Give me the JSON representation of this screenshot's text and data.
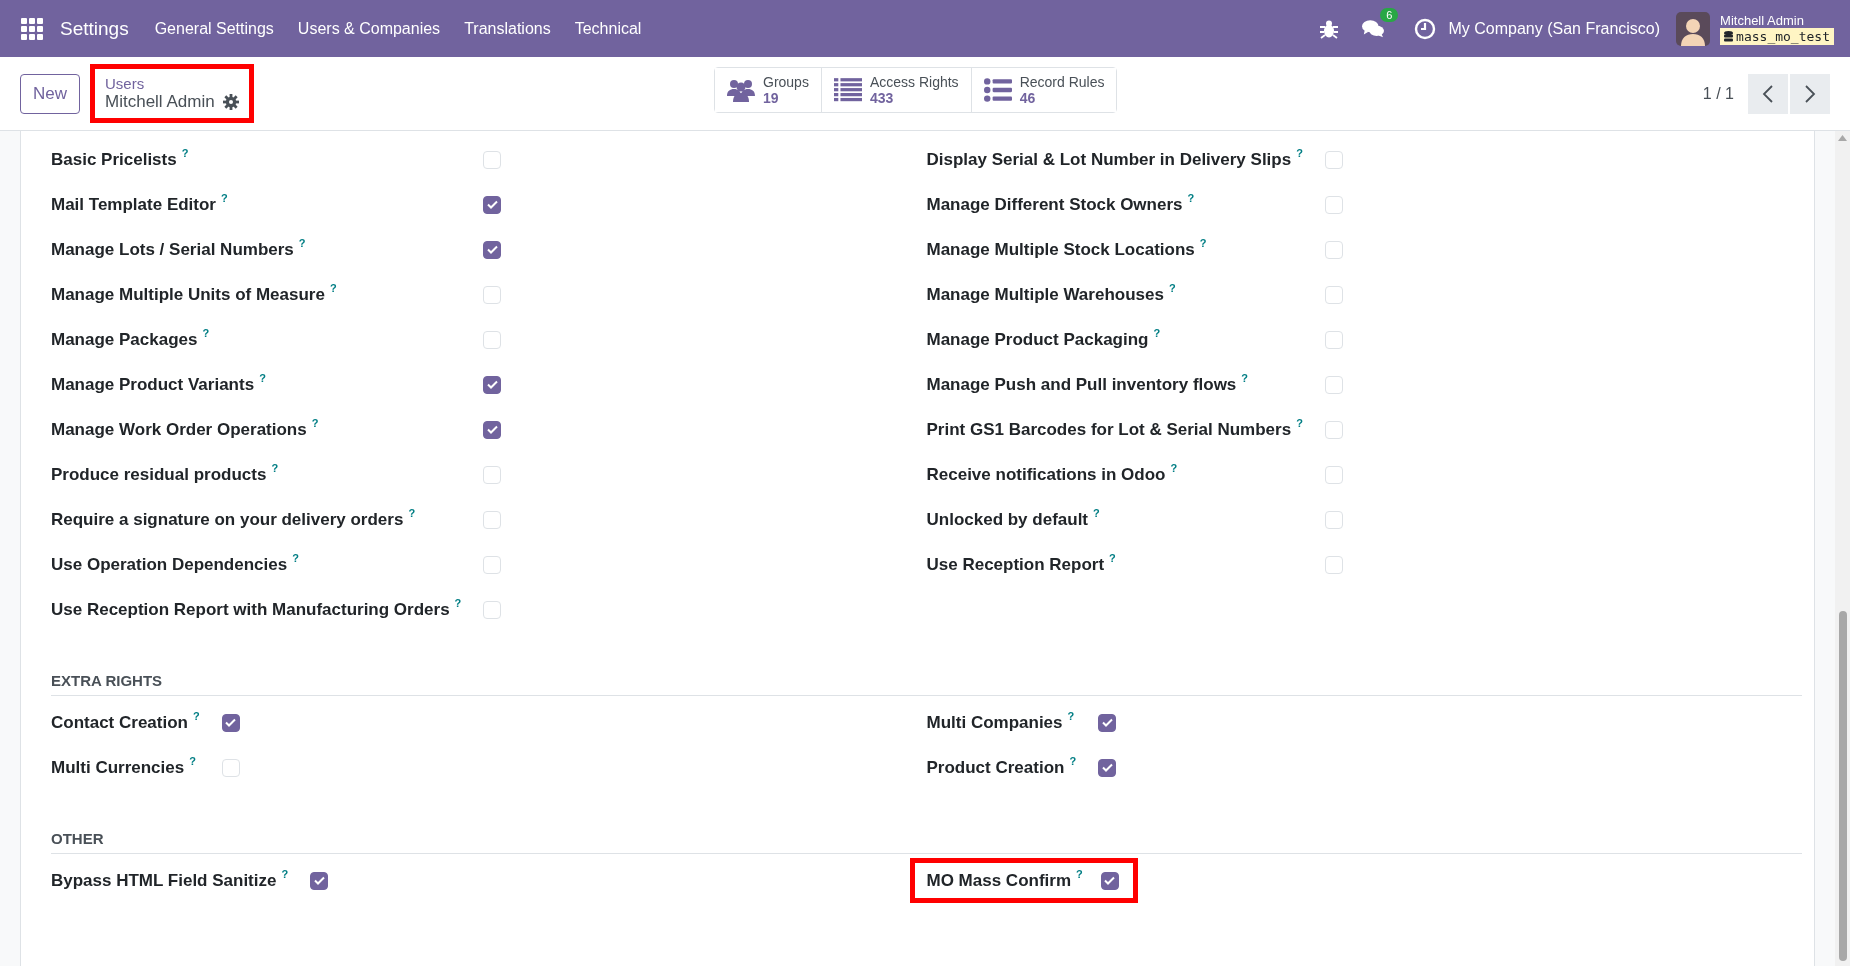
{
  "navbar": {
    "app_name": "Settings",
    "menu": [
      "General Settings",
      "Users & Companies",
      "Translations",
      "Technical"
    ],
    "message_count": "6",
    "company": "My Company (San Francisco)",
    "user": "Mitchell Admin",
    "database": "mass_mo_test"
  },
  "control_panel": {
    "new_button": "New",
    "breadcrumb": {
      "parent": "Users",
      "current": "Mitchell Admin",
      "highlighted": true
    },
    "stat_buttons": [
      {
        "kind": "groups",
        "label": "Groups",
        "value": "19"
      },
      {
        "kind": "list",
        "label": "Access Rights",
        "value": "433"
      },
      {
        "kind": "bullets",
        "label": "Record Rules",
        "value": "46"
      }
    ],
    "pager": "1 / 1"
  },
  "sections": [
    {
      "columns": [
        [
          {
            "label": "Basic Pricelists",
            "help": "?",
            "checked": false,
            "highlighted": false
          },
          {
            "label": "Mail Template Editor",
            "help": "?",
            "checked": true,
            "highlighted": false
          },
          {
            "label": "Manage Lots / Serial Numbers",
            "help": "?",
            "checked": true,
            "highlighted": false
          },
          {
            "label": "Manage Multiple Units of Measure",
            "help": "?",
            "checked": false,
            "highlighted": false
          },
          {
            "label": "Manage Packages",
            "help": "?",
            "checked": false,
            "highlighted": false
          },
          {
            "label": "Manage Product Variants",
            "help": "?",
            "checked": true,
            "highlighted": false
          },
          {
            "label": "Manage Work Order Operations",
            "help": "?",
            "checked": true,
            "highlighted": false
          },
          {
            "label": "Produce residual products",
            "help": "?",
            "checked": false,
            "highlighted": false
          },
          {
            "label": "Require a signature on your delivery orders",
            "help": "?",
            "checked": false,
            "highlighted": false
          },
          {
            "label": "Use Operation Dependencies",
            "help": "?",
            "checked": false,
            "highlighted": false
          },
          {
            "label": "Use Reception Report with Manufacturing Orders",
            "help": "?",
            "checked": false,
            "highlighted": false
          }
        ],
        [
          {
            "label": "Display Serial & Lot Number in Delivery Slips",
            "help": "?",
            "checked": false,
            "highlighted": false
          },
          {
            "label": "Manage Different Stock Owners",
            "help": "?",
            "checked": false,
            "highlighted": false
          },
          {
            "label": "Manage Multiple Stock Locations",
            "help": "?",
            "checked": false,
            "highlighted": false
          },
          {
            "label": "Manage Multiple Warehouses",
            "help": "?",
            "checked": false,
            "highlighted": false
          },
          {
            "label": "Manage Product Packaging",
            "help": "?",
            "checked": false,
            "highlighted": false
          },
          {
            "label": "Manage Push and Pull inventory flows",
            "help": "?",
            "checked": false,
            "highlighted": false
          },
          {
            "label": "Print GS1 Barcodes for Lot & Serial Numbers",
            "help": "?",
            "checked": false,
            "highlighted": false
          },
          {
            "label": "Receive notifications in Odoo",
            "help": "?",
            "checked": false,
            "highlighted": false
          },
          {
            "label": "Unlocked by default",
            "help": "?",
            "checked": false,
            "highlighted": false
          },
          {
            "label": "Use Reception Report",
            "help": "?",
            "checked": false,
            "highlighted": false
          }
        ]
      ]
    },
    {
      "title": "EXTRA RIGHTS",
      "columns": [
        [
          {
            "label": "Contact Creation",
            "help": "?",
            "checked": true,
            "highlighted": false
          },
          {
            "label": "Multi Currencies",
            "help": "?",
            "checked": false,
            "highlighted": false
          }
        ],
        [
          {
            "label": "Multi Companies",
            "help": "?",
            "checked": true,
            "highlighted": false
          },
          {
            "label": "Product Creation",
            "help": "?",
            "checked": true,
            "highlighted": false
          }
        ]
      ]
    },
    {
      "title": "OTHER",
      "columns": [
        [
          {
            "label": "Bypass HTML Field Sanitize",
            "help": "?",
            "checked": true,
            "highlighted": false
          }
        ],
        [
          {
            "label": "MO Mass Confirm",
            "help": "?",
            "checked": true,
            "highlighted": true
          }
        ]
      ]
    }
  ]
}
